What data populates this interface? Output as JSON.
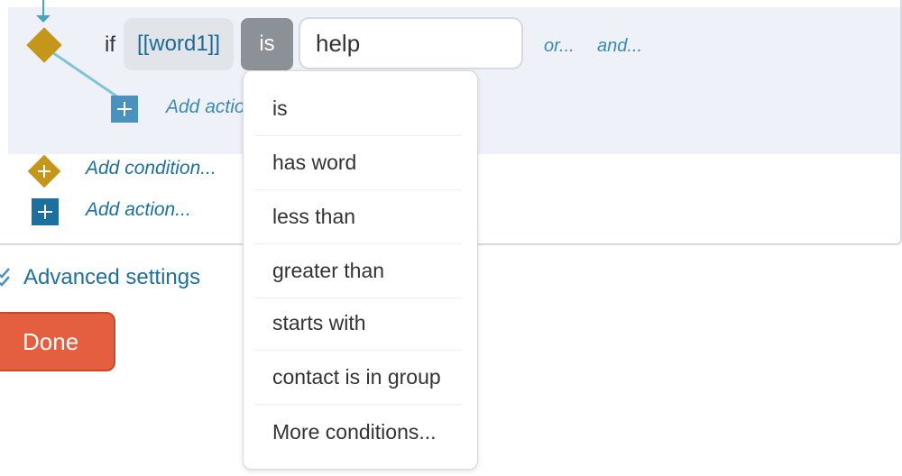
{
  "rule": {
    "if_label": "if",
    "variable": "[[word1]]",
    "operator": "is",
    "value": "help",
    "or_link": "or...",
    "and_link": "and...",
    "inner_add_action": "Add action..."
  },
  "footer": {
    "add_condition": "Add condition...",
    "add_action": "Add action...",
    "advanced_settings": "Advanced settings",
    "done": "Done"
  },
  "operator_menu": {
    "items": [
      {
        "label": "is"
      },
      {
        "label": "has word"
      },
      {
        "label": "less than"
      },
      {
        "label": "greater than"
      },
      {
        "label": "starts with"
      },
      {
        "label": "contact is in group"
      },
      {
        "label": "More conditions..."
      }
    ]
  },
  "colors": {
    "link": "#1d6f9e",
    "condition_diamond": "#c4961a",
    "done_button": "#e35f3f",
    "operator_chip": "#8b9196"
  }
}
